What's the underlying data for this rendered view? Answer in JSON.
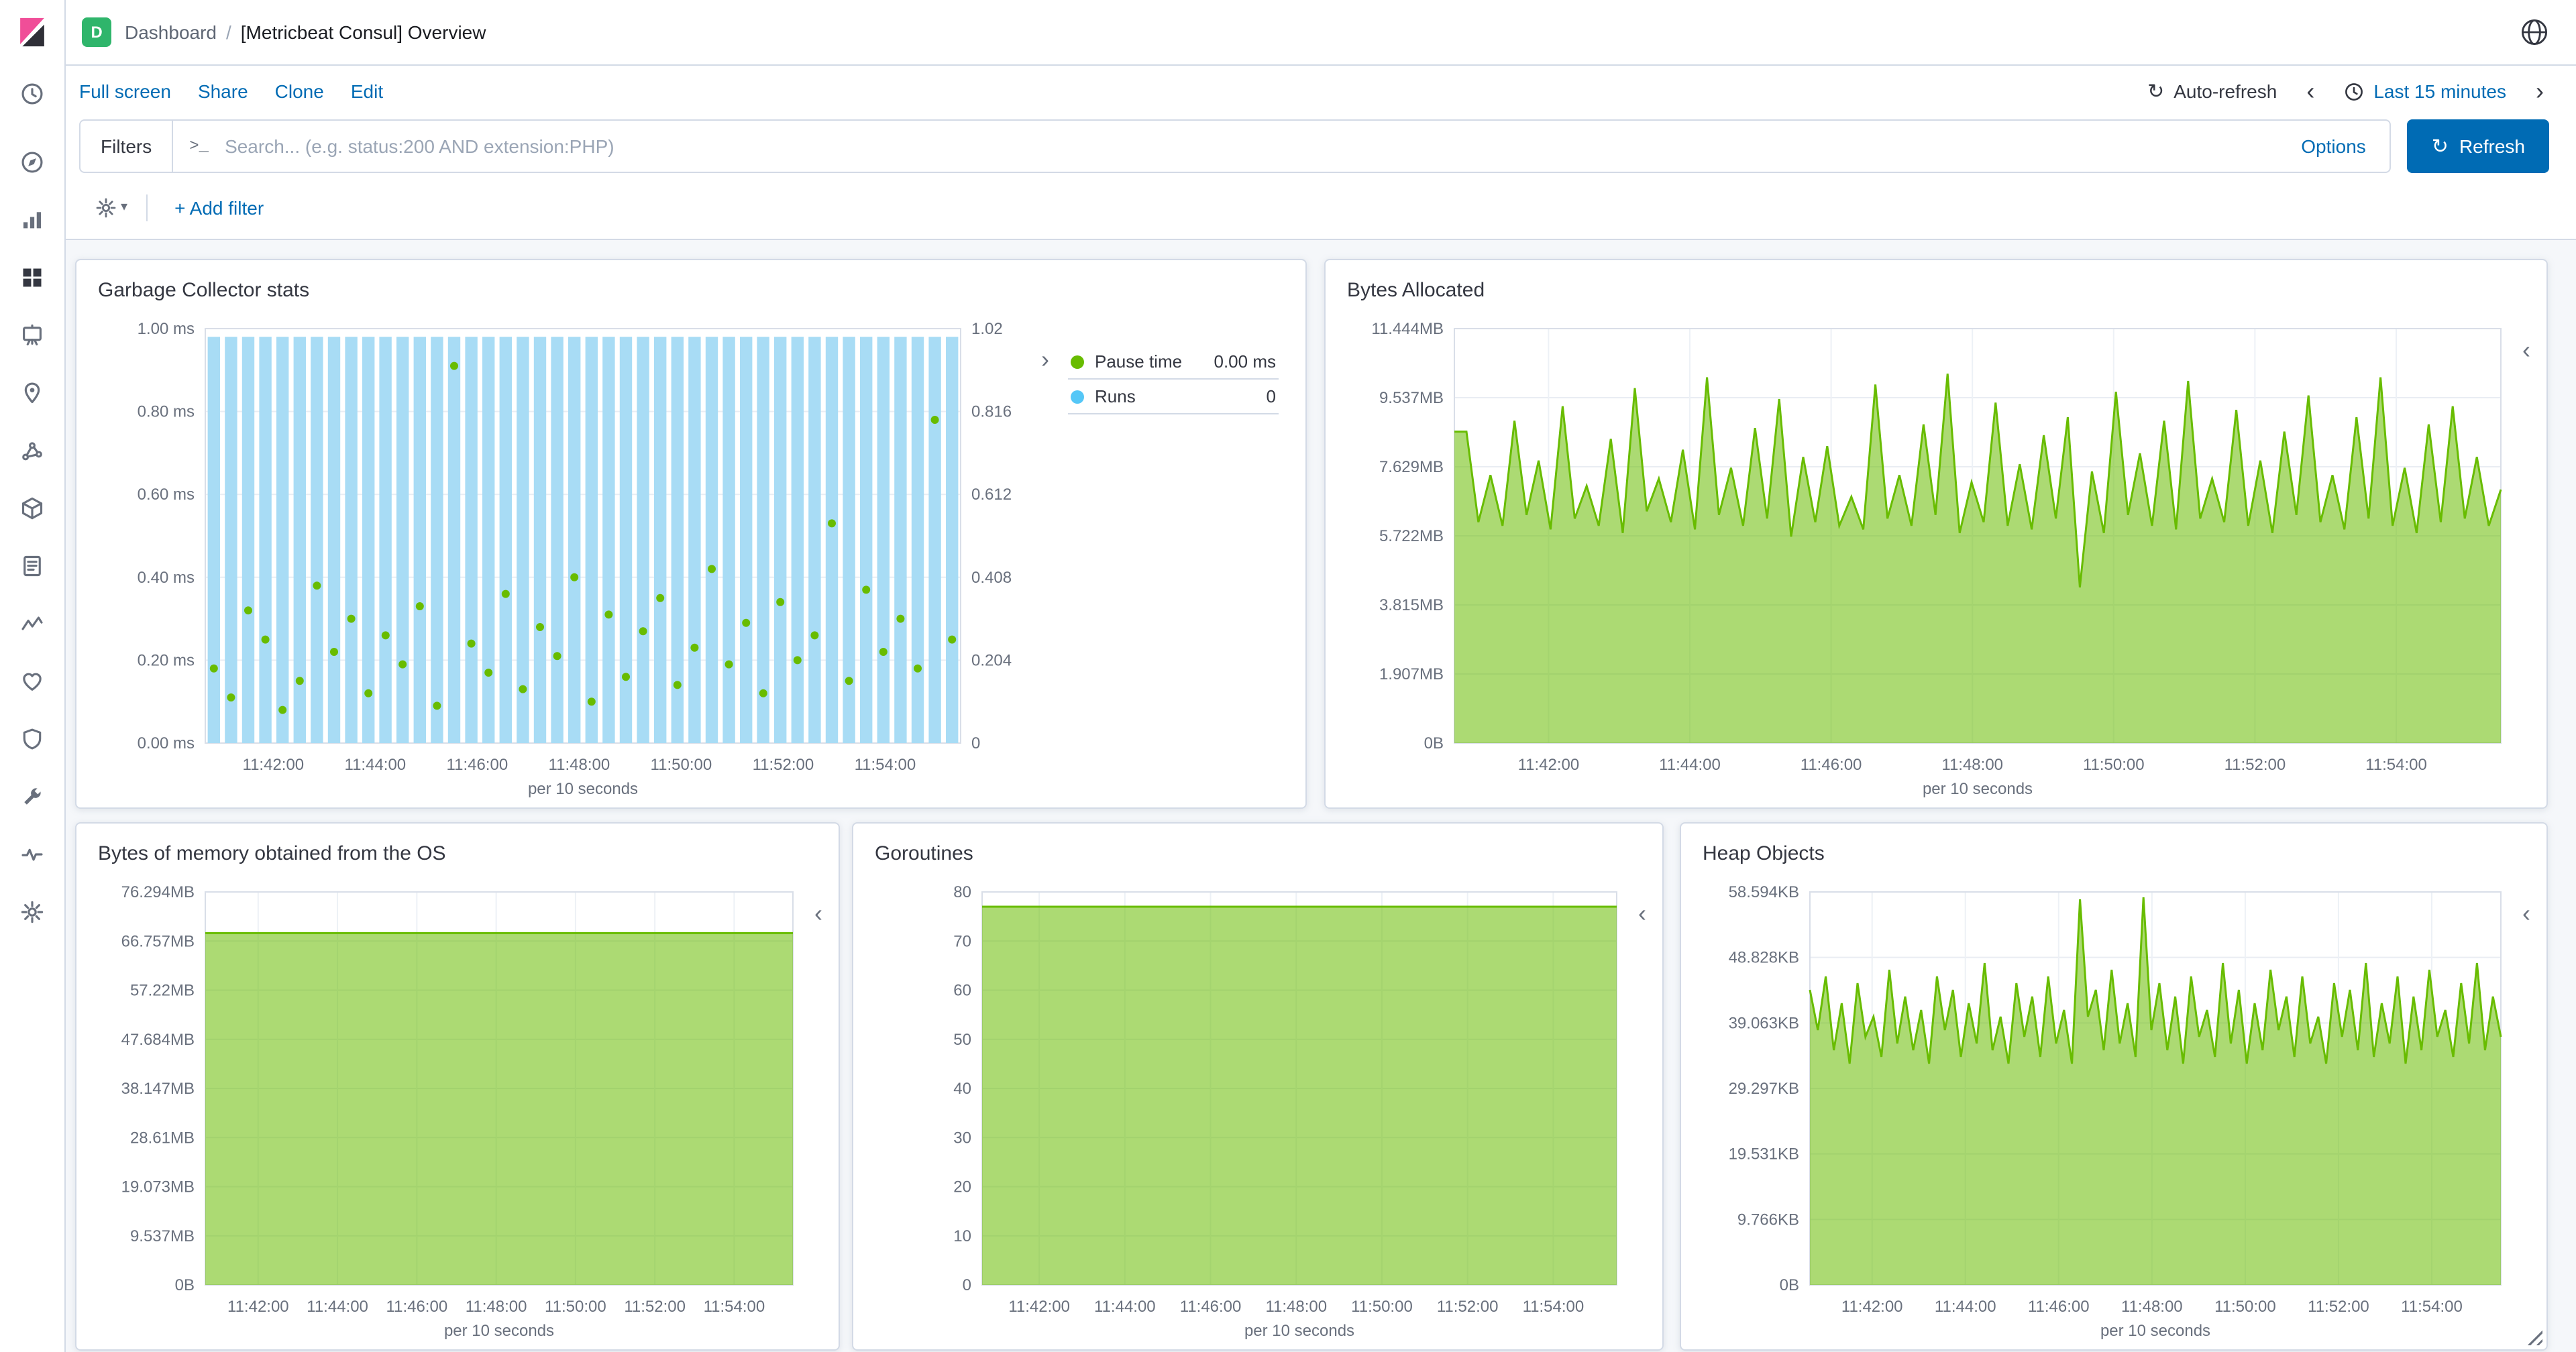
{
  "header": {
    "space": {
      "initial": "D",
      "color": "#2FB56B"
    },
    "breadcrumb": {
      "section": "Dashboard",
      "separator": "/",
      "page": "[Metricbeat Consul] Overview"
    }
  },
  "toolbar": {
    "links": [
      "Full screen",
      "Share",
      "Clone",
      "Edit"
    ],
    "auto_refresh": "Auto-refresh",
    "time_range": "Last 15 minutes"
  },
  "query_bar": {
    "filters_button": "Filters",
    "prompt": ">_",
    "placeholder": "Search... (e.g. status:200 AND extension:PHP)",
    "options": "Options",
    "refresh": "Refresh"
  },
  "filter_bar": {
    "add_filter": "+ Add filter"
  },
  "icons": {
    "chevron_left": "‹",
    "chevron_right": "›",
    "refresh": "↻",
    "caret_down": "▾"
  },
  "sidebar": {
    "icons": [
      "recently-viewed",
      "discover",
      "visualize",
      "dashboard",
      "canvas",
      "maps",
      "machine-learning",
      "infrastructure",
      "logs",
      "apm",
      "uptime",
      "siem",
      "dev-tools",
      "monitoring",
      "management"
    ],
    "active": "dashboard"
  },
  "colors": {
    "primary": "#006BB4",
    "link": "#006BB4",
    "page_background": "#F5F7FA",
    "panel_border": "#D3DAE6",
    "series_green": "#68BC00",
    "series_blue": "#A8DCF5"
  },
  "chart_data": [
    {
      "id": "garbage-collector-stats",
      "type": "bar",
      "title": "Garbage Collector stats",
      "x_ticks": [
        "11:42:00",
        "11:44:00",
        "11:46:00",
        "11:48:00",
        "11:50:00",
        "11:52:00",
        "11:54:00"
      ],
      "x_caption": "per 10 seconds",
      "left_axis": {
        "labels": [
          "0.00 ms",
          "0.20 ms",
          "0.40 ms",
          "0.60 ms",
          "0.80 ms",
          "1.00 ms"
        ],
        "max": 1.0
      },
      "right_axis": {
        "labels": [
          "0",
          "0.204",
          "0.408",
          "0.612",
          "0.816",
          "1.02"
        ],
        "max": 1.02
      },
      "legend_position": "right",
      "series": [
        {
          "name": "Pause time",
          "type": "scatter",
          "axis": "left",
          "color": "#68BC00",
          "legend_value": "0.00 ms",
          "values": [
            0.18,
            0.11,
            0.32,
            0.25,
            0.08,
            0.15,
            0.38,
            0.22,
            0.3,
            0.12,
            0.26,
            0.19,
            0.33,
            0.09,
            0.91,
            0.24,
            0.17,
            0.36,
            0.13,
            0.28,
            0.21,
            0.4,
            0.1,
            0.31,
            0.16,
            0.27,
            0.35,
            0.14,
            0.23,
            0.42,
            0.19,
            0.29,
            0.12,
            0.34,
            0.2,
            0.26,
            0.53,
            0.15,
            0.37,
            0.22,
            0.3,
            0.18,
            0.78,
            0.25
          ]
        },
        {
          "name": "Runs",
          "type": "bar",
          "axis": "right",
          "color": "#A8DCF5",
          "legend_color": "#55C7F7",
          "legend_value": "0",
          "constant": 1,
          "points": 44
        }
      ]
    },
    {
      "id": "bytes-allocated",
      "type": "area",
      "title": "Bytes Allocated",
      "x_ticks": [
        "11:42:00",
        "11:44:00",
        "11:46:00",
        "11:48:00",
        "11:50:00",
        "11:52:00",
        "11:54:00"
      ],
      "x_caption": "per 10 seconds",
      "left_axis": {
        "labels": [
          "0B",
          "1.907MB",
          "3.815MB",
          "5.722MB",
          "7.629MB",
          "9.537MB",
          "11.444MB"
        ],
        "max": 11.444
      },
      "series": [
        {
          "name": "Bytes Allocated",
          "type": "area",
          "color": "#68BC00",
          "fill_opacity": 0.55,
          "unit": "MB",
          "values": [
            8.6,
            8.6,
            6.1,
            7.4,
            6.0,
            8.9,
            6.3,
            7.8,
            5.9,
            9.3,
            6.2,
            7.1,
            6.0,
            8.4,
            5.8,
            9.8,
            6.4,
            7.3,
            6.1,
            8.1,
            5.9,
            10.1,
            6.3,
            7.6,
            6.0,
            8.7,
            6.2,
            9.5,
            5.7,
            7.9,
            6.1,
            8.2,
            6.0,
            6.8,
            5.9,
            9.9,
            6.2,
            7.4,
            6.0,
            8.8,
            6.3,
            10.2,
            5.8,
            7.2,
            6.1,
            9.4,
            6.0,
            7.7,
            5.9,
            8.5,
            6.2,
            9.0,
            4.3,
            7.5,
            5.8,
            9.7,
            6.3,
            8.0,
            6.0,
            8.9,
            5.9,
            10.0,
            6.2,
            7.3,
            6.1,
            9.2,
            6.0,
            7.8,
            5.8,
            8.6,
            6.3,
            9.6,
            6.1,
            7.4,
            5.9,
            9.0,
            6.2,
            10.1,
            6.0,
            7.6,
            5.8,
            8.8,
            6.1,
            9.3,
            6.2,
            7.9,
            6.0,
            7.0
          ]
        }
      ]
    },
    {
      "id": "bytes-memory-os",
      "type": "area",
      "title": "Bytes of memory obtained from the OS",
      "x_ticks": [
        "11:42:00",
        "11:44:00",
        "11:46:00",
        "11:48:00",
        "11:50:00",
        "11:52:00",
        "11:54:00"
      ],
      "x_caption": "per 10 seconds",
      "left_axis": {
        "labels": [
          "0B",
          "9.537MB",
          "19.073MB",
          "28.61MB",
          "38.147MB",
          "47.684MB",
          "57.22MB",
          "66.757MB",
          "76.294MB"
        ],
        "max": 76.294
      },
      "series": [
        {
          "name": "Bytes of memory obtained from the OS",
          "type": "area",
          "color": "#68BC00",
          "fill_opacity": 0.55,
          "unit": "MB",
          "constant": 68.3,
          "points": 88
        }
      ]
    },
    {
      "id": "goroutines",
      "type": "area",
      "title": "Goroutines",
      "x_ticks": [
        "11:42:00",
        "11:44:00",
        "11:46:00",
        "11:48:00",
        "11:50:00",
        "11:52:00",
        "11:54:00"
      ],
      "x_caption": "per 10 seconds",
      "left_axis": {
        "labels": [
          "0",
          "10",
          "20",
          "30",
          "40",
          "50",
          "60",
          "70",
          "80"
        ],
        "max": 80
      },
      "series": [
        {
          "name": "Goroutines",
          "type": "area",
          "color": "#68BC00",
          "fill_opacity": 0.55,
          "constant": 77,
          "points": 88
        }
      ]
    },
    {
      "id": "heap-objects",
      "type": "area",
      "title": "Heap Objects",
      "x_ticks": [
        "11:42:00",
        "11:44:00",
        "11:46:00",
        "11:48:00",
        "11:50:00",
        "11:52:00",
        "11:54:00"
      ],
      "x_caption": "per 10 seconds",
      "left_axis": {
        "labels": [
          "0B",
          "9.766KB",
          "19.531KB",
          "29.297KB",
          "39.063KB",
          "48.828KB",
          "58.594KB"
        ],
        "max": 58.594
      },
      "series": [
        {
          "name": "Heap Objects",
          "type": "area",
          "color": "#68BC00",
          "fill_opacity": 0.55,
          "unit": "KB",
          "values": [
            44,
            38,
            46,
            35,
            42,
            33,
            45,
            37,
            40,
            34,
            47,
            36,
            43,
            35,
            41,
            33,
            46,
            38,
            44,
            34,
            42,
            36,
            48,
            35,
            40,
            33,
            45,
            37,
            43,
            34,
            46,
            36,
            41,
            33,
            57.5,
            40,
            44,
            35,
            47,
            36,
            42,
            34,
            57.8,
            38,
            45,
            35,
            43,
            33,
            46,
            37,
            41,
            34,
            48,
            36,
            44,
            33,
            42,
            35,
            47,
            38,
            43,
            34,
            46,
            36,
            40,
            33,
            45,
            37,
            44,
            35,
            48,
            34,
            42,
            36,
            46,
            33,
            43,
            35,
            47,
            37,
            41,
            34,
            45,
            36,
            48,
            35,
            43,
            37
          ]
        }
      ]
    }
  ]
}
